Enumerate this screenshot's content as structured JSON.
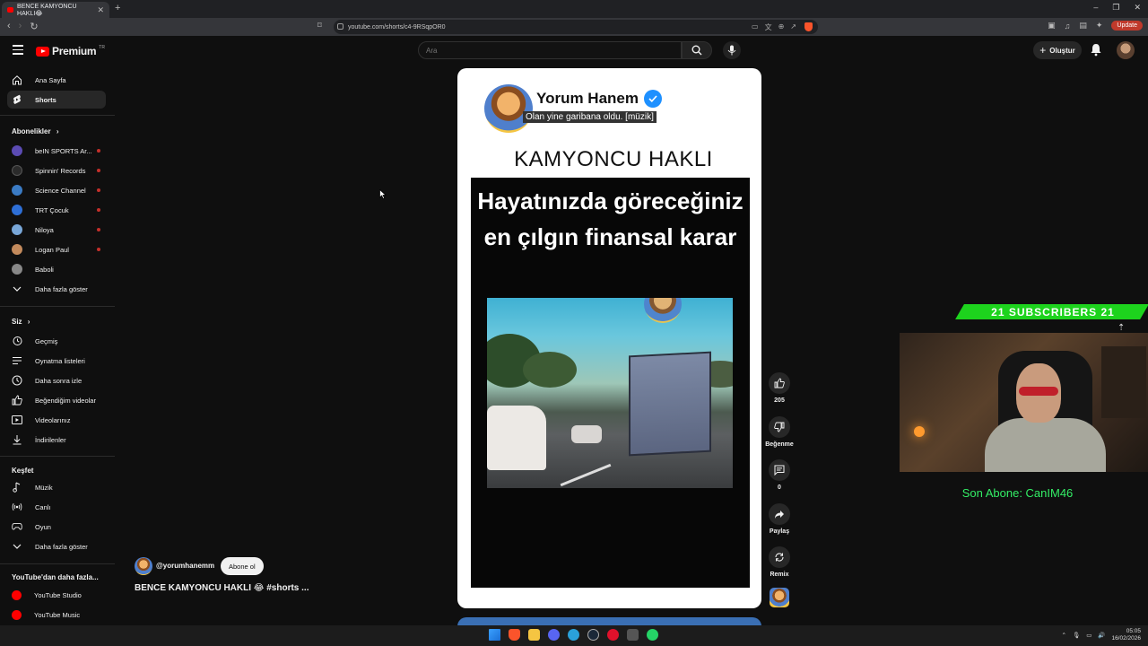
{
  "browser": {
    "tab_title": "BENCE KAMYONCU HAKLI😂",
    "url": "youtube.com/shorts/c4-9RSqpOR0",
    "update_label": "Update"
  },
  "header": {
    "logo_text": "Premium",
    "logo_region": "TR",
    "search_placeholder": "Ara",
    "create_label": "Oluştur"
  },
  "sidebar": {
    "main": [
      {
        "label": "Ana Sayfa",
        "icon": "home-icon"
      },
      {
        "label": "Shorts",
        "icon": "shorts-icon"
      }
    ],
    "subscriptions_heading": "Abonelikler",
    "subscriptions": [
      {
        "label": "beIN SPORTS Ar...",
        "color": "#5b4bb3"
      },
      {
        "label": "Spinnin' Records",
        "color": "#2b2b2b"
      },
      {
        "label": "Science Channel",
        "color": "#3b7bc4"
      },
      {
        "label": "TRT Çocuk",
        "color": "#2e6fd6"
      },
      {
        "label": "Niloya",
        "color": "#79a7d8"
      },
      {
        "label": "Logan Paul",
        "color": "#c38a5c"
      },
      {
        "label": "Baboli",
        "color": "#888888"
      }
    ],
    "show_more": "Daha fazla göster",
    "you_heading": "Siz",
    "you_items": [
      {
        "label": "Geçmiş",
        "icon": "history-icon"
      },
      {
        "label": "Oynatma listeleri",
        "icon": "playlists-icon"
      },
      {
        "label": "Daha sonra izle",
        "icon": "watch-later-icon"
      },
      {
        "label": "Beğendiğim videolar",
        "icon": "liked-icon"
      },
      {
        "label": "Videolarınız",
        "icon": "your-videos-icon"
      },
      {
        "label": "İndirilenler",
        "icon": "downloads-icon"
      }
    ],
    "explore_heading": "Keşfet",
    "explore_items": [
      {
        "label": "Müzik",
        "icon": "music-icon"
      },
      {
        "label": "Canlı",
        "icon": "live-icon"
      },
      {
        "label": "Oyun",
        "icon": "gaming-icon"
      }
    ],
    "explore_more": "Daha fazla göster",
    "more_heading": "YouTube'dan daha fazla...",
    "more_items": [
      {
        "label": "YouTube Studio"
      },
      {
        "label": "YouTube Music"
      }
    ]
  },
  "video": {
    "overlay_channel": "Yorum Hanem",
    "overlay_caption": "Olan yine garibana oldu. [müzik]",
    "headline": "KAMYONCU HAKLI",
    "inner_title": "Hayatınızda göreceğiniz en çılgın finansal karar"
  },
  "actions": {
    "like_count": "205",
    "dislike_label": "Beğenme",
    "comment_count": "0",
    "share_label": "Paylaş",
    "remix_label": "Remix"
  },
  "info": {
    "handle": "@yorumhanemm",
    "subscribe_label": "Abone ol",
    "title": "BENCE KAMYONCU HAKLI 😂 #shorts ..."
  },
  "overlay": {
    "subscribers_text": "21   SUBSCRIBERS   21",
    "last_sub_text": "Son Abone: CanIM46"
  },
  "taskbar": {
    "time": "05:05",
    "date": "16/02/2026"
  }
}
